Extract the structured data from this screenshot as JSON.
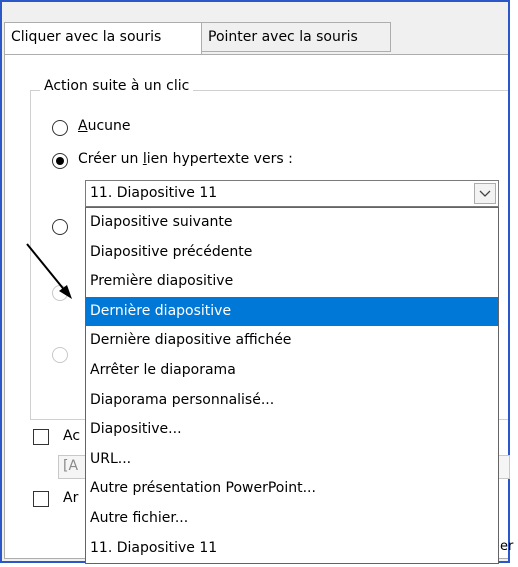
{
  "tabs": [
    {
      "label": "Cliquer avec la souris",
      "active": true
    },
    {
      "label": "Pointer avec la souris",
      "active": false
    }
  ],
  "group": {
    "legend": "Action suite à un clic"
  },
  "options": {
    "none_prefix": "",
    "none_accel": "A",
    "none_rest": "ucune",
    "link_prefix": "Créer un ",
    "link_accel": "l",
    "link_rest": "ien hypertexte vers :"
  },
  "combo": {
    "value": "11. Diapositive 11"
  },
  "dropdown": {
    "items": [
      "Diapositive suivante",
      "Diapositive précédente",
      "Première diapositive",
      "Dernière diapositive",
      "Dernière diapositive affichée",
      "Arrêter le diaporama",
      "Diaporama personnalisé...",
      "Diapositive...",
      "URL...",
      "Autre présentation PowerPoint...",
      "Autre fichier...",
      "11. Diapositive 11"
    ],
    "selected_index": 3
  },
  "partial": {
    "check1": "Ac",
    "field": "[A",
    "check2": "Ar",
    "btn": "er"
  },
  "colors": {
    "frame": "#2b58c8",
    "highlight": "#0078d7"
  }
}
